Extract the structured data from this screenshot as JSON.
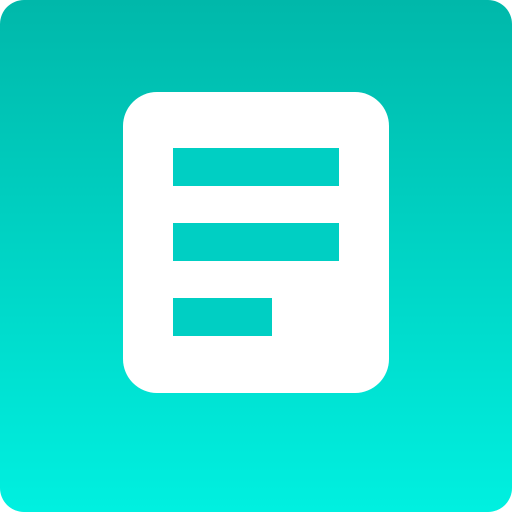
{
  "icon": {
    "name": "document-icon",
    "colors": {
      "gradient_top": "#00b8aa",
      "gradient_bottom": "#00f0e0",
      "card": "#ffffff",
      "lines": "#00cfc3"
    }
  }
}
